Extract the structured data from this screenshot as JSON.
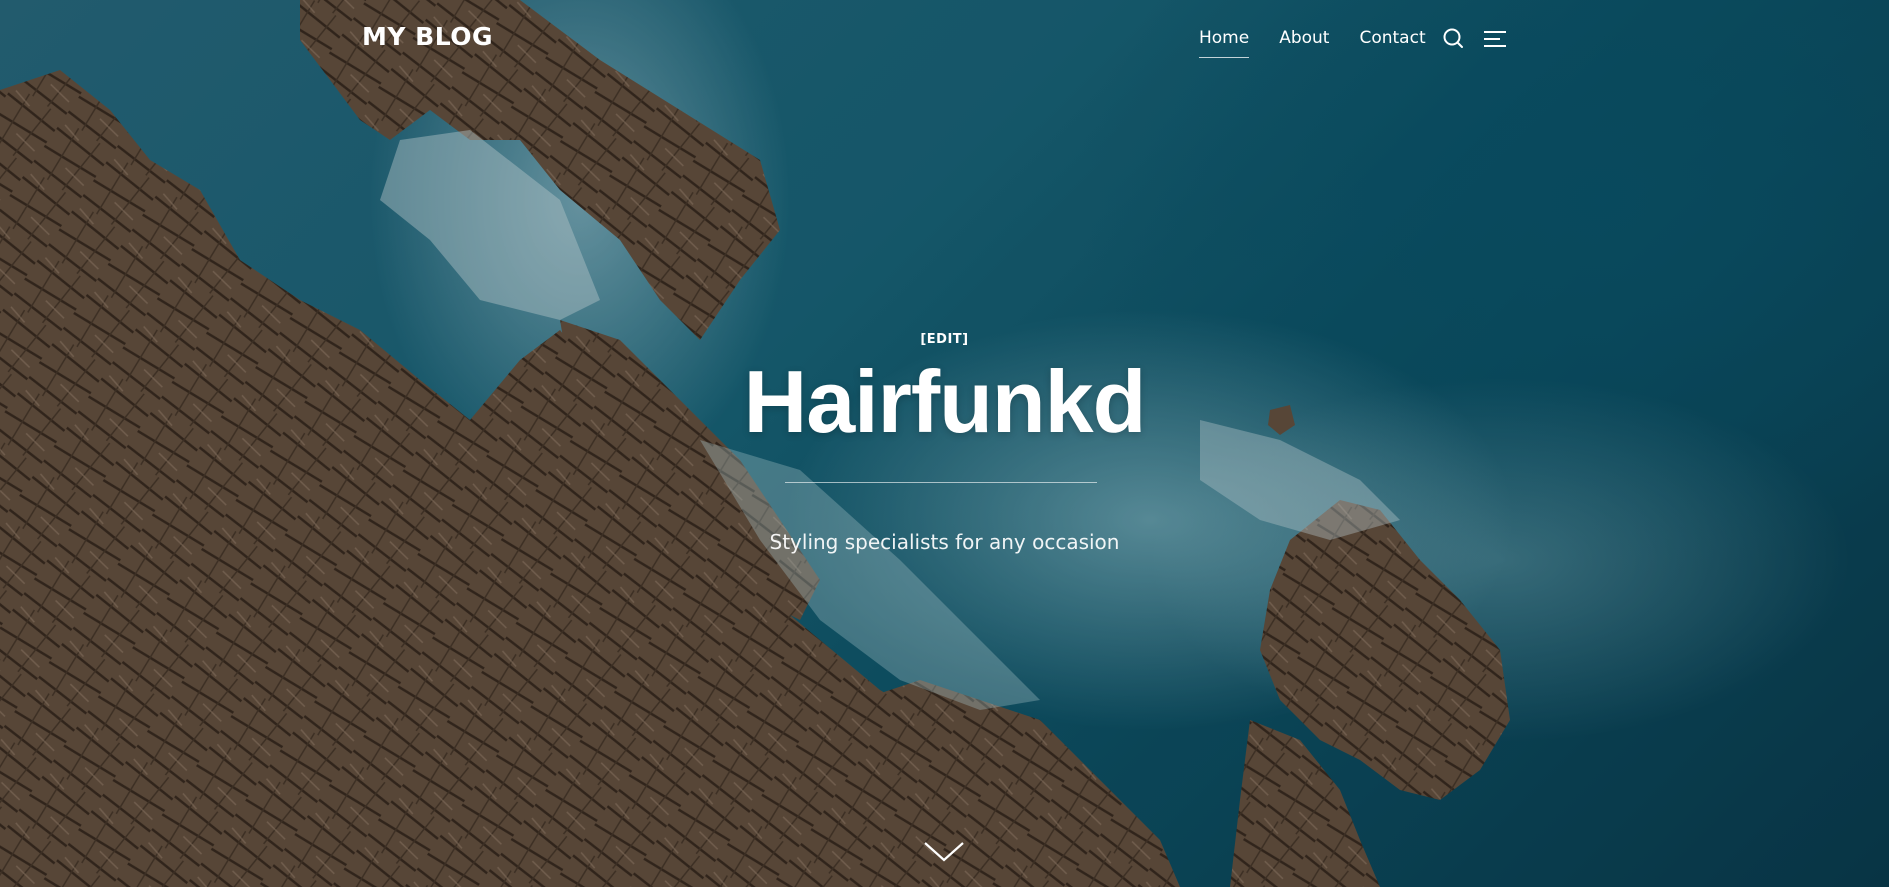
{
  "header": {
    "site_title": "MY BLOG",
    "nav": [
      {
        "label": "Home",
        "active": true
      },
      {
        "label": "About",
        "active": false
      },
      {
        "label": "Contact",
        "active": false
      }
    ],
    "icons": {
      "search": "search-icon",
      "menu": "menu-icon"
    }
  },
  "hero": {
    "edit_label": "[EDIT]",
    "title": "Hairfunkd",
    "tagline": "Styling specialists for any occasion",
    "scroll_icon": "chevron-down-icon"
  },
  "colors": {
    "text": "#ffffff",
    "ocean": "#0f5a70",
    "rock": "#6e5a48"
  }
}
